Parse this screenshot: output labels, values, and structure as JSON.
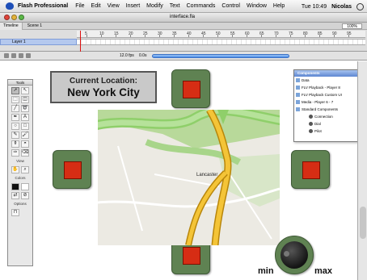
{
  "menubar": {
    "app_name": "Flash Professional",
    "items": [
      "File",
      "Edit",
      "View",
      "Insert",
      "Modify",
      "Text",
      "Commands",
      "Control",
      "Window",
      "Help"
    ],
    "time": "Tue 10:49",
    "user": "Nicolas"
  },
  "window": {
    "title": "interface.fla",
    "traffic_colors": [
      "#e0443a",
      "#e4b33a",
      "#5bb848"
    ]
  },
  "timeline": {
    "tab_label": "Timeline",
    "scene_label": "Scene 1",
    "zoom": "100%",
    "layer_name": "Layer 1",
    "frame_numbers": [
      "5",
      "10",
      "15",
      "20",
      "25",
      "30",
      "35",
      "40",
      "45",
      "50",
      "55",
      "60",
      "65",
      "70",
      "75",
      "80",
      "85",
      "90",
      "95"
    ],
    "current_frame": 1,
    "fps_label": "12.0 fps",
    "time_label": "0.0s"
  },
  "tools": {
    "title": "Tools",
    "view_label": "View",
    "colors_label": "Colors",
    "options_label": "Options",
    "icon_names": [
      "arrow-tool-icon",
      "subselect-tool-icon",
      "free-transform-icon",
      "fill-transform-icon",
      "line-tool-icon",
      "lasso-tool-icon",
      "pen-tool-icon",
      "text-tool-icon",
      "oval-tool-icon",
      "rectangle-tool-icon",
      "pencil-tool-icon",
      "brush-tool-icon",
      "ink-bottle-icon",
      "paint-bucket-icon",
      "eyedropper-icon",
      "eraser-icon"
    ],
    "glyphs": [
      "➚",
      "↖",
      "⬚",
      "◫",
      "╱",
      "➰",
      "✒",
      "A",
      "○",
      "□",
      "✎",
      "🖌",
      "⚱",
      "◓",
      "✑",
      "⌫"
    ]
  },
  "stage": {
    "location_line1": "Current Location:",
    "location_line2": "New York City",
    "button_color": "#5f8252",
    "square_color": "#d62d14",
    "knob_min": "min",
    "knob_max": "max",
    "knob_level": 0.2
  },
  "map_labels": [
    "Lancaster"
  ],
  "components": {
    "title": "Components",
    "items": [
      {
        "label": "Data",
        "icon": "folder-icon"
      },
      {
        "label": "FLV Playback - Player 8",
        "icon": "folder-icon"
      },
      {
        "label": "FLV Playback Custom UI",
        "icon": "folder-icon"
      },
      {
        "label": "Media - Player 6 - 7",
        "icon": "folder-icon"
      },
      {
        "label": "Standard Components",
        "icon": "folder-icon"
      },
      {
        "label": "Connection",
        "icon": "component-icon",
        "sub": true
      },
      {
        "label": "Dial",
        "icon": "component-icon",
        "sub": true
      },
      {
        "label": "Pilot",
        "icon": "component-icon",
        "sub": true
      }
    ]
  }
}
